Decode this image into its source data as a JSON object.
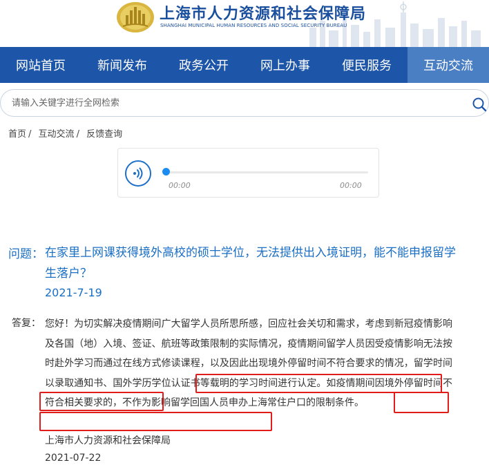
{
  "header": {
    "title": "上海市人力资源和社会保障局",
    "subtitle": "SHANGHAI MUNICIPAL HUMAN RESOURCES AND SOCIAL SECURITY BUREAU"
  },
  "nav": {
    "items": [
      {
        "label": "网站首页"
      },
      {
        "label": "新闻发布"
      },
      {
        "label": "政务公开"
      },
      {
        "label": "网上办事"
      },
      {
        "label": "便民服务"
      },
      {
        "label": "互动交流",
        "active": true
      }
    ]
  },
  "search": {
    "placeholder": "请输入关键字进行全网检索",
    "value": ""
  },
  "breadcrumb": [
    "首页",
    "互动交流",
    "反馈查询"
  ],
  "player": {
    "current_time": "00:00",
    "duration": "00:00",
    "progress": 0
  },
  "question": {
    "label": "问题：",
    "text": "在家里上网课获得境外高校的硕士学位，无法提供出入境证明，能不能申报留学生落户？",
    "date": "2021-7-19"
  },
  "answer": {
    "label": "答复：",
    "text": "您好！为切实解决疫情期间广大留学人员所思所感，回应社会关切和需求，考虑到新冠疫情影响及各国（地）入境、签证、航班等政策限制的实际情况，疫情期间留学人员因受疫情影响无法按时赴外学习而通过在线方式修读课程，以及因此出现境外停留时间不符合要求的情况，留学时间以录取通知书、国外学历学位认证书等载明的学习时间进行认定。如疫情期间因境外停留时间不符合相关要求的，不作为影响留学回国人员申办上海常住户口的限制条件。",
    "signature": "上海市人力资源和社会保障局",
    "date": "2021-07-22"
  },
  "colors": {
    "brand_blue": "#1d55a8",
    "nav_active": "#4a7fc4",
    "question_blue": "#1a6fc4",
    "highlight_red": "#e11a1a"
  }
}
